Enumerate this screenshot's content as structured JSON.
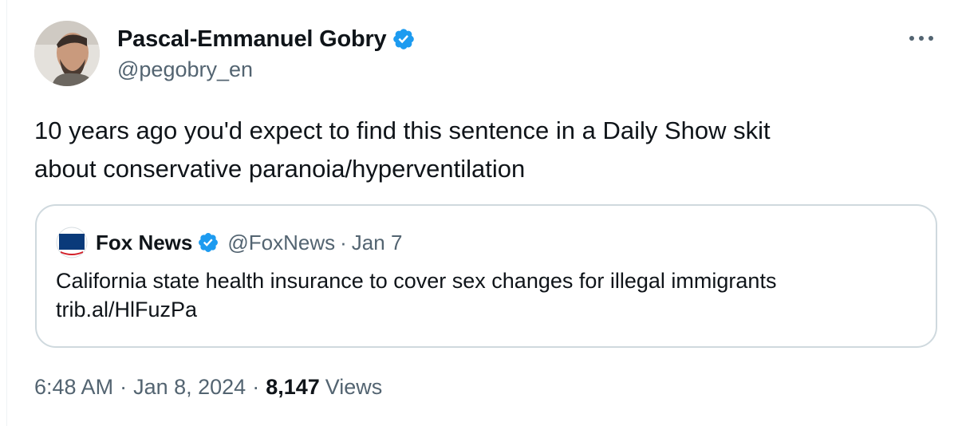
{
  "author": {
    "name": "Pascal-Emmanuel Gobry",
    "handle": "@pegobry_en",
    "verified_icon": "verified-badge-icon"
  },
  "tweet": {
    "text_line1": "10 years ago you'd expect to find this sentence in a Daily Show skit",
    "text_line2": "about conservative paranoia/hyperventilation"
  },
  "quoted_tweet": {
    "name": "Fox News",
    "handle": "@FoxNews",
    "separator": "·",
    "date": "Jan 7",
    "text": "California state health insurance to cover sex changes for illegal immigrants",
    "link": "trib.al/HlFuzPa"
  },
  "meta": {
    "time": "6:48 AM",
    "separator": "·",
    "date": "Jan 8, 2024",
    "views_count": "8,147",
    "views_label": "Views"
  },
  "colors": {
    "verified_blue": "#1d9bf0",
    "secondary_text": "#536471",
    "primary_text": "#0f1419",
    "border": "#cfd9de"
  }
}
